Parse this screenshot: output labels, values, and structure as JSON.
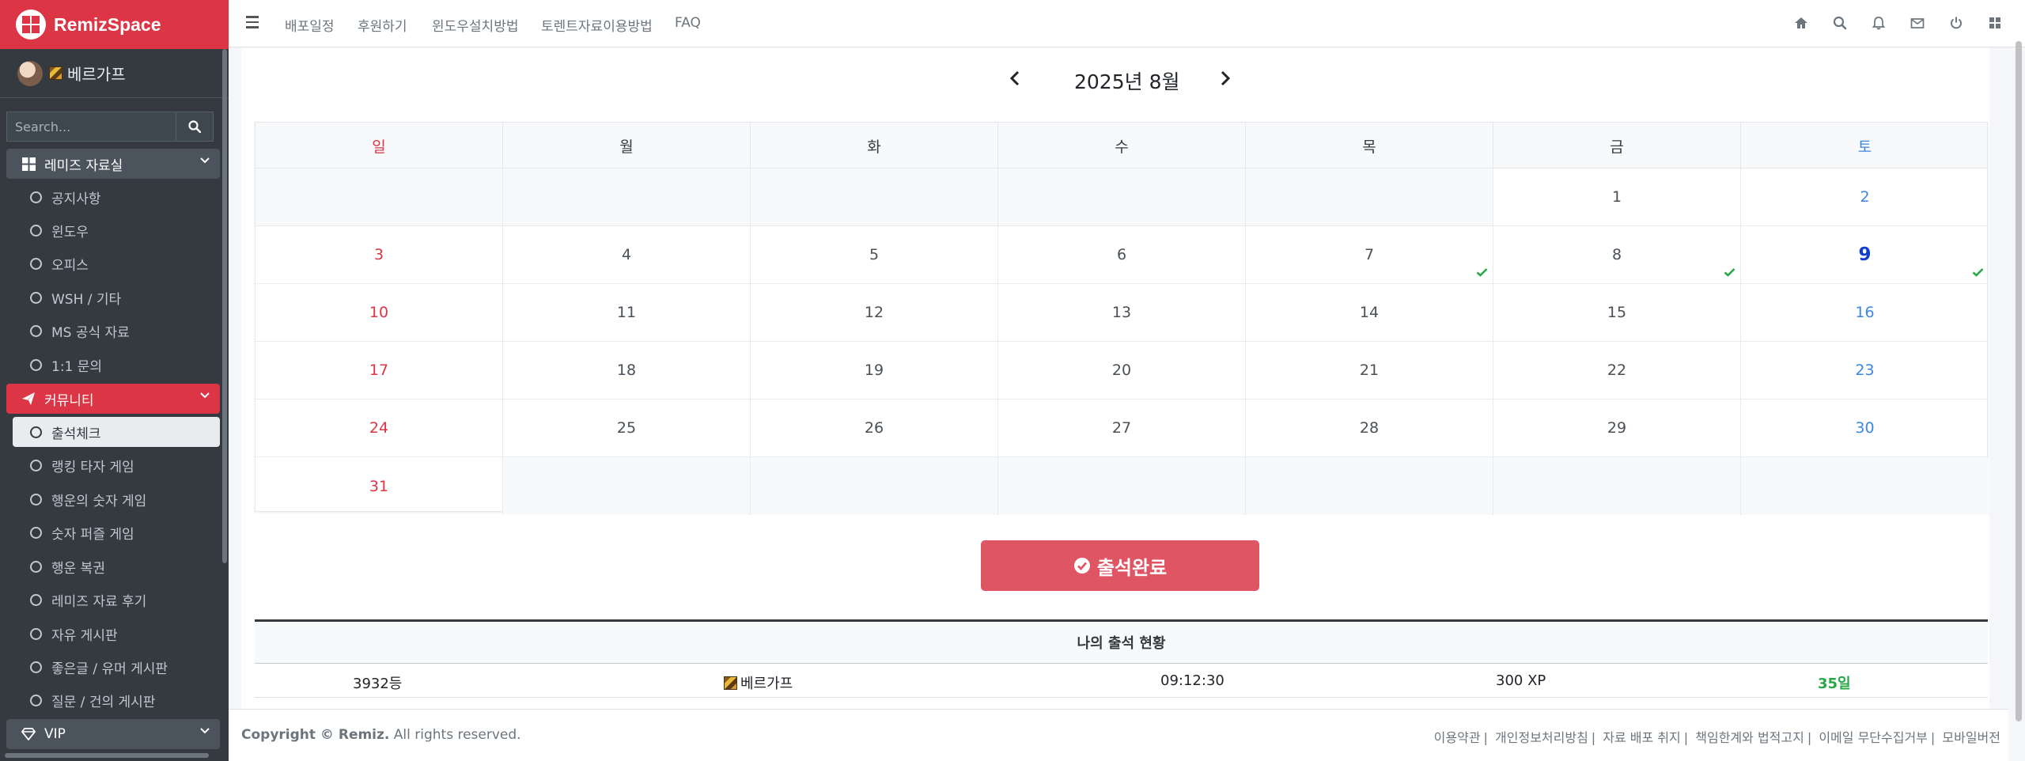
{
  "brand": {
    "name": "RemizSpace",
    "color": "#dc3545"
  },
  "user": {
    "name": "베르가프"
  },
  "sidebar_search": {
    "placeholder": "Search..."
  },
  "sidebar": {
    "section1": {
      "title": "레미즈 자료실",
      "items": [
        "공지사항",
        "윈도우",
        "오피스",
        "WSH / 기타",
        "MS 공식 자료",
        "1:1 문의"
      ]
    },
    "section2": {
      "title": "커뮤니티",
      "items": [
        "출석체크",
        "랭킹 타자 게임",
        "행운의 숫자 게임",
        "숫자 퍼즐 게임",
        "행운 복권",
        "레미즈 자료 후기",
        "자유 게시판",
        "좋은글 / 유머 게시판",
        "질문 / 건의 게시판"
      ],
      "active_index": 0
    },
    "section3": {
      "title": "VIP"
    }
  },
  "topnav": {
    "links": [
      "배포일정",
      "후원하기",
      "윈도우설치방법",
      "토렌트자료이용방법",
      "FAQ"
    ],
    "icons": [
      "home-icon",
      "search-icon",
      "bell-icon",
      "envelope-icon",
      "power-icon",
      "grid-icon"
    ]
  },
  "calendar": {
    "month_title": "2025년 8월",
    "weekdays": [
      "일",
      "월",
      "화",
      "수",
      "목",
      "금",
      "토"
    ],
    "rows": [
      [
        "",
        "",
        "",
        "",
        "",
        "1",
        "2"
      ],
      [
        "3",
        "4",
        "5",
        "6",
        "7",
        "8",
        "9"
      ],
      [
        "10",
        "11",
        "12",
        "13",
        "14",
        "15",
        "16"
      ],
      [
        "17",
        "18",
        "19",
        "20",
        "21",
        "22",
        "23"
      ],
      [
        "24",
        "25",
        "26",
        "27",
        "28",
        "29",
        "30"
      ],
      [
        "31",
        "",
        "",
        "",
        "",
        "",
        ""
      ]
    ],
    "checked_days": [
      "7",
      "8",
      "9"
    ],
    "today": "9",
    "colors": {
      "sunday": "#dc3545",
      "saturday": "#3b88e0",
      "today": "#0d3fd0",
      "check": "#28a745"
    }
  },
  "attendance_button": {
    "label": "출석완료"
  },
  "status": {
    "title": "나의 출석 현황",
    "rank": "3932등",
    "name": "베르가프",
    "time": "09:12:30",
    "xp": "300 XP",
    "days": "35일",
    "days_color": "#28a745"
  },
  "footer": {
    "copyright_prefix": "Copyright © Remiz.",
    "copyright_suffix": " All rights reserved.",
    "links": [
      "이용약관",
      "개인정보처리방침",
      "자료 배포 취지",
      "책임한계와 법적고지",
      "이메일 무단수집거부",
      "모바일버전"
    ]
  }
}
